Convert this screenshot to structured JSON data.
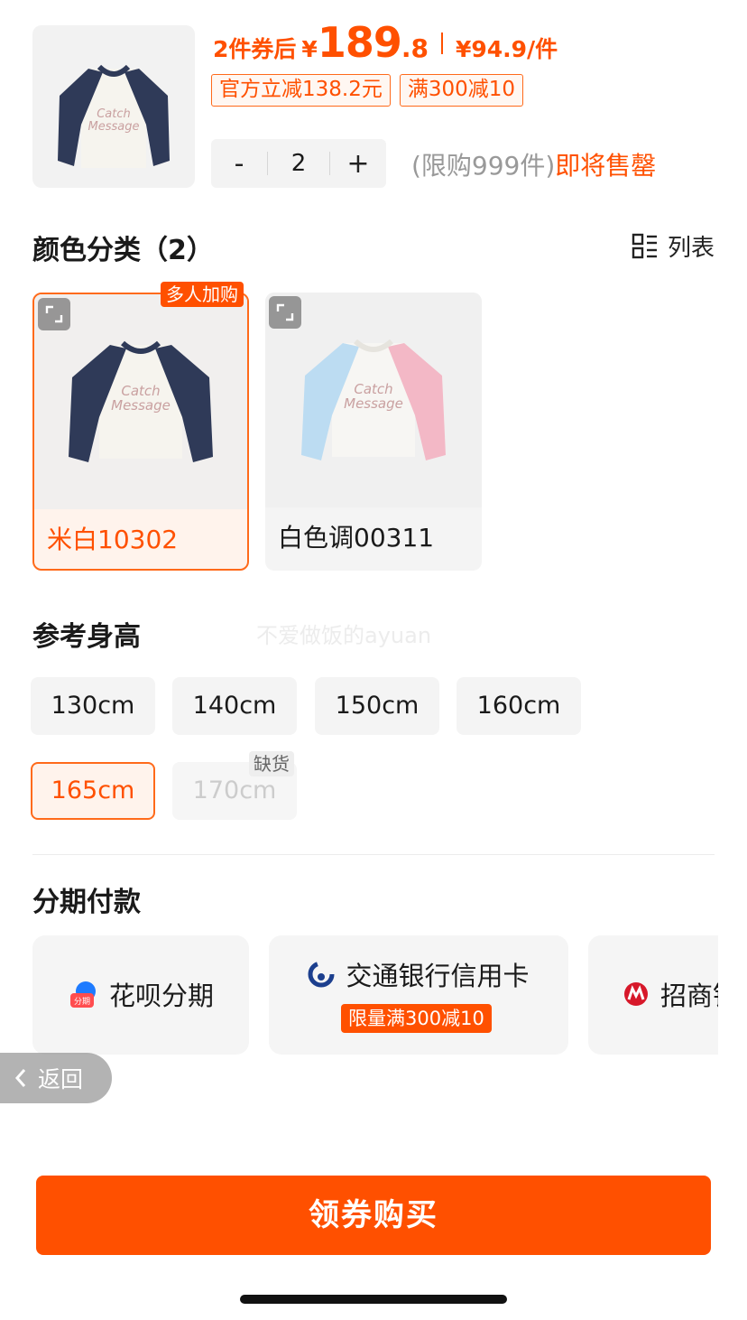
{
  "product": {
    "price_label": "2件券后",
    "currency": "¥",
    "price_int": "189",
    "price_dec": ".8",
    "unit_price": "¥94.9/件",
    "coupons": [
      "官方立减138.2元",
      "满300减10"
    ],
    "quantity": "2",
    "qty_minus": "-",
    "qty_plus": "+",
    "limit_text": "(限购999件)",
    "stock_text": "即将售罄"
  },
  "color_section": {
    "title": "颜色分类（2）",
    "view_toggle": "列表",
    "hot_tag": "多人加购",
    "options": [
      {
        "name": "米白10302",
        "selected": true
      },
      {
        "name": "白色调00311",
        "selected": false
      }
    ]
  },
  "watermark": "不爱做饭的ayuan",
  "height_section": {
    "title": "参考身高",
    "oos_tag": "缺货",
    "sizes": [
      "130cm",
      "140cm",
      "150cm",
      "160cm",
      "165cm",
      "170cm"
    ],
    "selected": "165cm",
    "unavailable": "170cm"
  },
  "installment": {
    "title": "分期付款",
    "options": [
      {
        "label": "花呗分期",
        "icon_text": "分期"
      },
      {
        "label": "交通银行信用卡",
        "promo": "限量满300减10"
      },
      {
        "label": "招商银"
      }
    ]
  },
  "back_label": "返回",
  "buy_label": "领券购买",
  "colors": {
    "accent": "#ff5000",
    "navy": "#2b3552",
    "pink": "#f3b8c6",
    "sky": "#bcdcf2"
  }
}
